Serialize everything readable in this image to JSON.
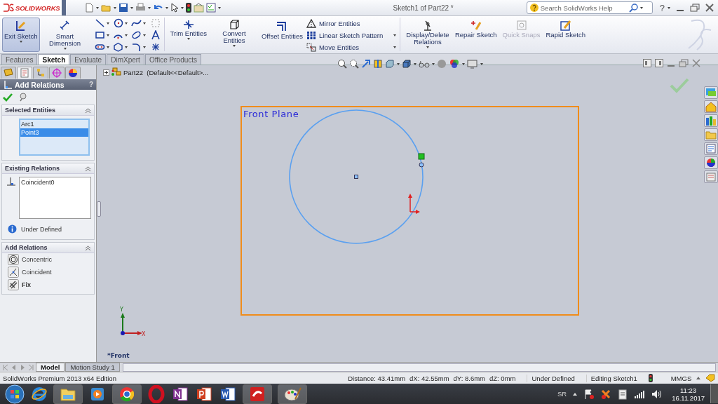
{
  "title_bar": {
    "logo": "SOLIDWORKS",
    "document_title": "Sketch1 of Part22 *",
    "search": {
      "placeholder": "Search SolidWorks Help"
    },
    "help": "?"
  },
  "ribbon": {
    "large_buttons": [
      {
        "label": "Exit Sketch",
        "selected": true,
        "disabled": false
      },
      {
        "label": "Smart Dimension",
        "selected": false,
        "disabled": false
      }
    ],
    "edit_buttons": [
      {
        "label": "Trim Entities",
        "disabled": false
      },
      {
        "label": "Convert Entities",
        "disabled": false
      },
      {
        "label": "Offset Entities",
        "disabled": false
      }
    ],
    "small_items": [
      "Mirror Entities",
      "Linear Sketch Pattern",
      "Move Entities"
    ],
    "right_buttons": [
      {
        "label": "Display/Delete Relations",
        "disabled": false
      },
      {
        "label": "Repair Sketch",
        "disabled": false
      },
      {
        "label": "Quick Snaps",
        "disabled": true
      },
      {
        "label": "Rapid Sketch",
        "disabled": false
      }
    ]
  },
  "tabs": [
    {
      "label": "Features",
      "selected": false
    },
    {
      "label": "Sketch",
      "selected": true
    },
    {
      "label": "Evaluate",
      "selected": false
    },
    {
      "label": "DimXpert",
      "selected": false
    },
    {
      "label": "Office Products",
      "selected": false
    }
  ],
  "property_manager": {
    "title": "Add Relations",
    "help": "?",
    "selected_entities": {
      "heading": "Selected Entities",
      "items": [
        {
          "label": "Arc1",
          "selected": false
        },
        {
          "label": "Point3",
          "selected": true
        }
      ]
    },
    "existing_relations": {
      "heading": "Existing Relations",
      "items": [
        "Coincident0"
      ],
      "status": "Under Defined"
    },
    "add_relations": {
      "heading": "Add Relations",
      "items": [
        {
          "label": "Concentric",
          "bold": false
        },
        {
          "label": "Coincident",
          "bold": false
        },
        {
          "label": "Fix",
          "bold": true
        }
      ]
    }
  },
  "tree": {
    "label": "Part22  (Default<<Default>..."
  },
  "viewport": {
    "plane_label": "Front Plane",
    "view_label": "*Front",
    "axis_y": "Y",
    "axis_x": "X"
  },
  "bottom_tabs": [
    {
      "label": "Model",
      "selected": true
    },
    {
      "label": "Motion Study 1",
      "selected": false
    }
  ],
  "status_bar": {
    "edition": "SolidWorks Premium 2013 x64 Edition",
    "distance": "Distance: 43.41mm",
    "dx": "dX: 42.55mm",
    "dy": "dY: 8.6mm",
    "dz": "dZ: 0mm",
    "state": "Under Defined",
    "mode": "Editing Sketch1",
    "units": "MMGS"
  },
  "taskbar": {
    "language": "SR",
    "time": "11:23",
    "date": "16.11.2017"
  }
}
